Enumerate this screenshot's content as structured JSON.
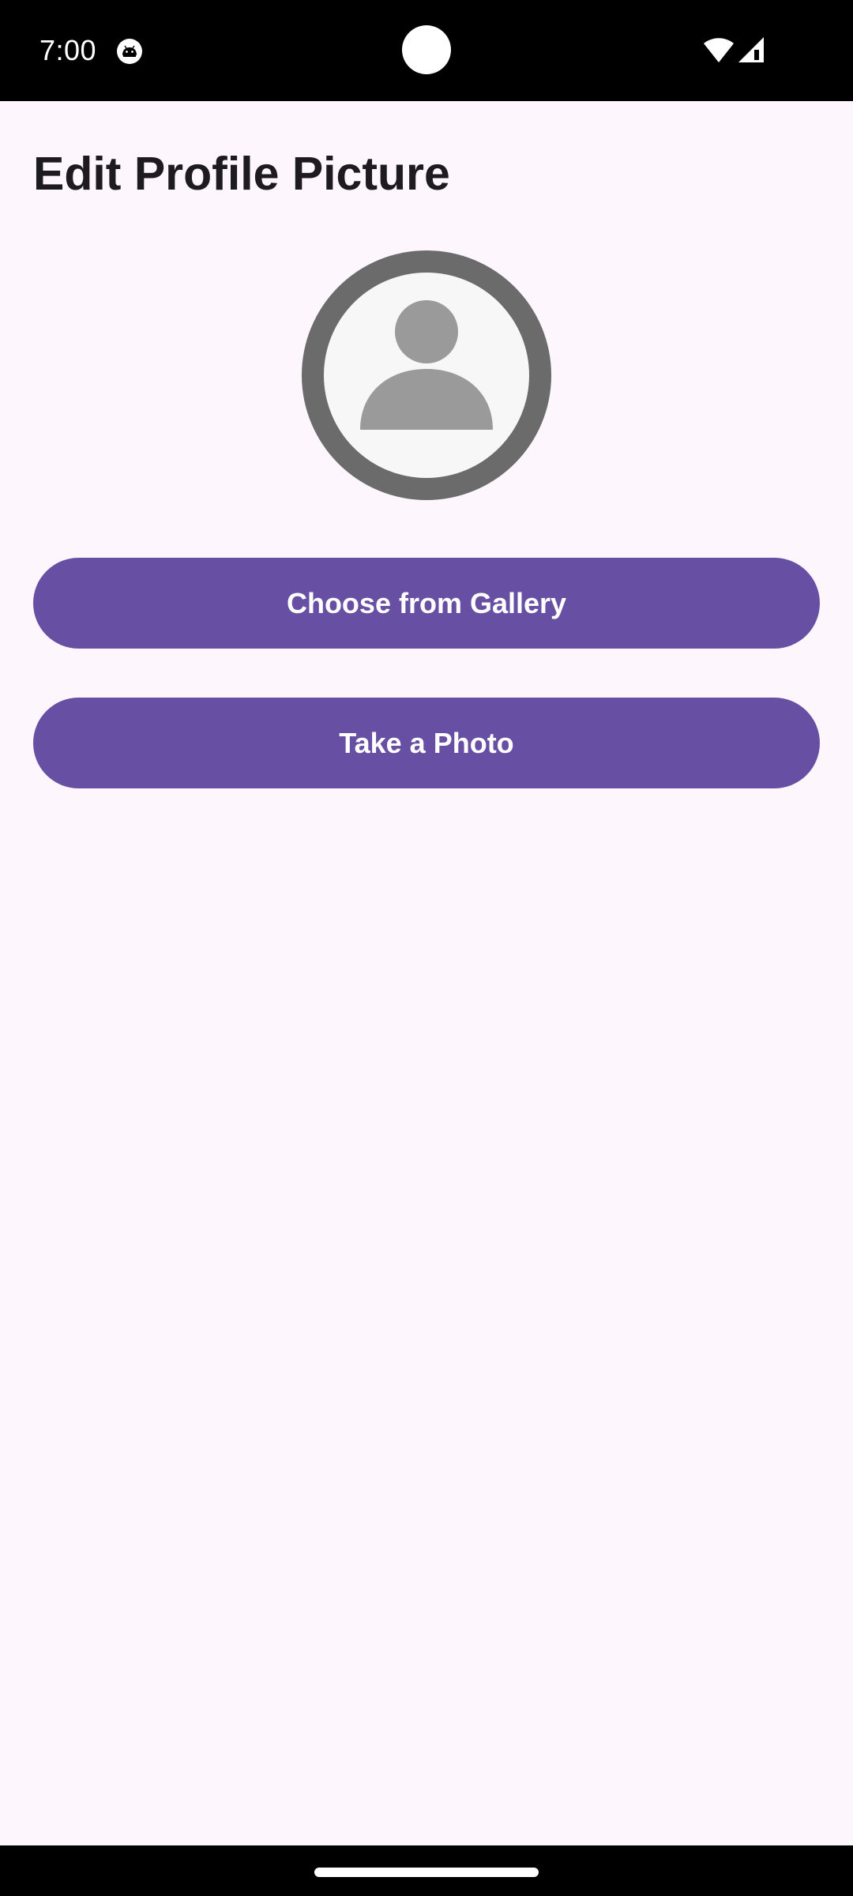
{
  "status_bar": {
    "time": "7:00",
    "icons": [
      "android-notification-icon",
      "wifi-icon",
      "cell-signal-icon"
    ]
  },
  "page": {
    "title": "Edit Profile Picture"
  },
  "avatar": {
    "icon": "person-icon"
  },
  "actions": {
    "gallery_label": "Choose from Gallery",
    "photo_label": "Take a Photo"
  },
  "colors": {
    "background": "#fdf6fd",
    "primary": "#6750a4",
    "avatar_ring": "#6b6b6b",
    "avatar_fill": "#f7f7f7",
    "avatar_icon": "#9a9a9a",
    "title_text": "#1d1b20"
  }
}
